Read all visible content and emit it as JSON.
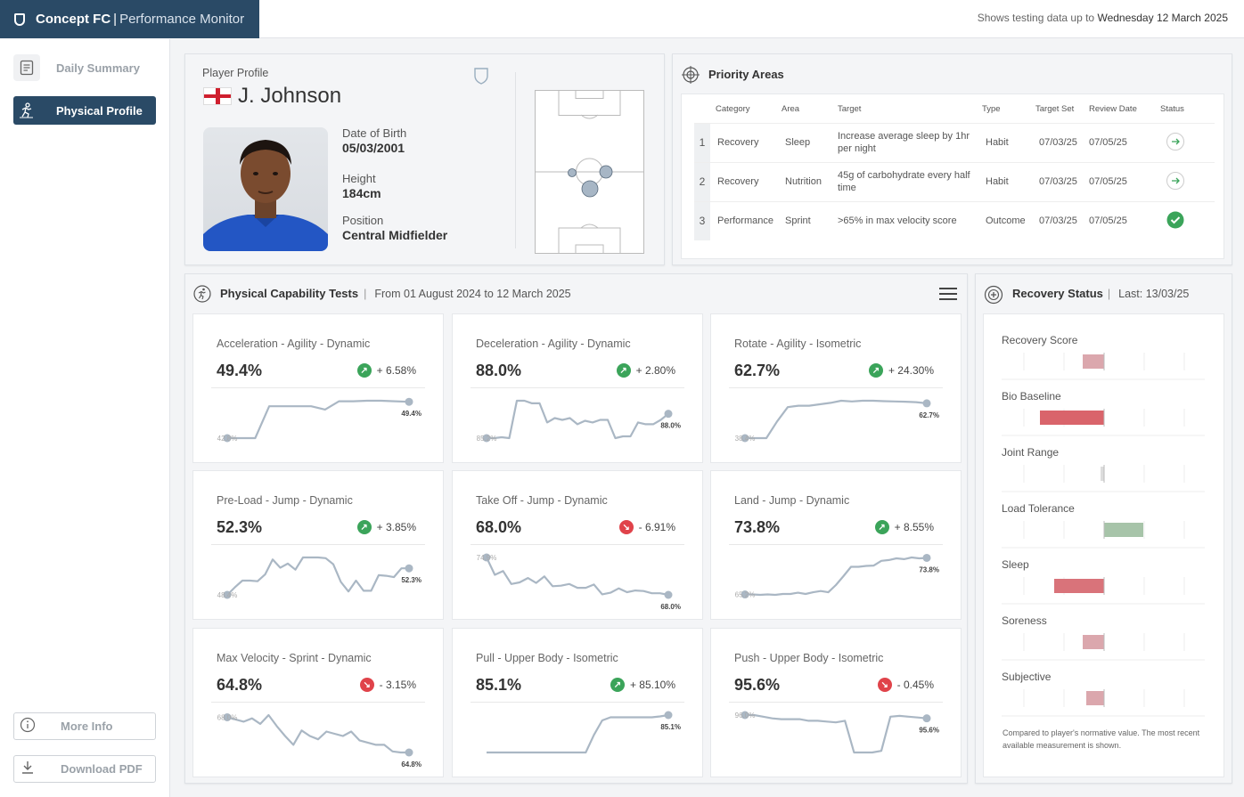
{
  "app": {
    "brand_bold": "Concept FC",
    "brand_sep": "|",
    "brand_rest": "Performance Monitor"
  },
  "data_notice": {
    "prefix": "Shows testing data up to",
    "date": "Wednesday 12 March 2025"
  },
  "sidebar": {
    "items": [
      {
        "label": "Daily Summary",
        "icon": "document-icon"
      },
      {
        "label": "Physical Profile",
        "icon": "runner-icon"
      }
    ],
    "more_info": "More Info",
    "download": "Download PDF"
  },
  "profile": {
    "section_label": "Player Profile",
    "name": "J. Johnson",
    "flag": "england-flag",
    "dob_label": "Date of Birth",
    "dob": "05/03/2001",
    "height_label": "Height",
    "height": "184cm",
    "position_label": "Position",
    "position": "Central Midfielder"
  },
  "priority": {
    "title": "Priority Areas",
    "headers": [
      "Category",
      "Area",
      "Target",
      "Type",
      "Target Set",
      "Review Date",
      "Status"
    ],
    "rows": [
      {
        "n": "1",
        "category": "Recovery",
        "area": "Sleep",
        "target": "Increase average sleep by 1hr per night",
        "type": "Habit",
        "set": "07/03/25",
        "review": "07/05/25",
        "status": "in-progress"
      },
      {
        "n": "2",
        "category": "Recovery",
        "area": "Nutrition",
        "target": "45g of carbohydrate every half time",
        "type": "Habit",
        "set": "07/03/25",
        "review": "07/05/25",
        "status": "in-progress"
      },
      {
        "n": "3",
        "category": "Performance",
        "area": "Sprint",
        "target": ">65% in max velocity score",
        "type": "Outcome",
        "set": "07/03/25",
        "review": "07/05/25",
        "status": "complete"
      }
    ]
  },
  "tests": {
    "title": "Physical Capability Tests",
    "range": "From 01 August 2024 to 12 March 2025",
    "cards": [
      {
        "title": "Acceleration - Agility - Dynamic",
        "value": "49.4%",
        "change": "+ 6.58%",
        "dir": "up",
        "start_label": "42.8%",
        "end_label": "49.4%",
        "series": [
          42.8,
          42.8,
          42.8,
          48.6,
          48.6,
          48.6,
          48.6,
          48.0,
          49.5,
          49.5,
          49.6,
          49.6,
          49.5,
          49.4
        ]
      },
      {
        "title": "Deceleration - Agility - Dynamic",
        "value": "88.0%",
        "change": "+ 2.80%",
        "dir": "up",
        "start_label": "85.2%",
        "end_label": "88.0%",
        "series": [
          85.2,
          85.2,
          85.3,
          85.2,
          89.5,
          89.5,
          89.2,
          89.2,
          87.0,
          87.5,
          87.3,
          87.5,
          86.8,
          87.2,
          87.0,
          87.3,
          87.3,
          85.2,
          85.4,
          85.4,
          87.0,
          86.8,
          86.8,
          87.3,
          88.0
        ]
      },
      {
        "title": "Rotate - Agility - Isometric",
        "value": "62.7%",
        "change": "+ 24.30%",
        "dir": "up",
        "start_label": "38.4%",
        "end_label": "62.7%",
        "series": [
          38.4,
          38.4,
          38.4,
          50.0,
          60.0,
          61.0,
          61.0,
          62.0,
          63.0,
          64.5,
          64.0,
          64.5,
          64.5,
          64.2,
          64.0,
          63.8,
          63.5,
          62.7
        ]
      },
      {
        "title": "Pre-Load - Jump - Dynamic",
        "value": "52.3%",
        "change": "+ 3.85%",
        "dir": "up",
        "start_label": "48.4%",
        "end_label": "52.3%",
        "series": [
          48.4,
          49.5,
          50.5,
          50.5,
          50.4,
          51.4,
          53.6,
          52.4,
          53.0,
          52.1,
          53.9,
          53.9,
          53.9,
          53.8,
          52.9,
          50.3,
          48.9,
          50.5,
          49.0,
          49.0,
          51.3,
          51.2,
          51.0,
          52.3,
          52.3
        ]
      },
      {
        "title": "Take Off - Jump - Dynamic",
        "value": "68.0%",
        "change": "- 6.91%",
        "dir": "down",
        "start_label": "74.9%",
        "end_label": "68.0%",
        "series": [
          74.9,
          71.7,
          72.4,
          70.0,
          70.3,
          71.1,
          70.2,
          71.4,
          69.6,
          69.7,
          70.0,
          69.3,
          69.3,
          69.9,
          68.1,
          68.4,
          69.2,
          68.5,
          68.8,
          68.7,
          68.3,
          68.3,
          68.0
        ]
      },
      {
        "title": "Land - Jump - Dynamic",
        "value": "73.8%",
        "change": "+ 8.55%",
        "dir": "up",
        "start_label": "65.2%",
        "end_label": "73.8%",
        "series": [
          65.2,
          65.2,
          65.1,
          65.2,
          65.1,
          65.3,
          65.3,
          65.6,
          65.3,
          65.7,
          66.0,
          65.7,
          67.4,
          69.5,
          71.7,
          71.7,
          71.9,
          72.0,
          73.1,
          73.3,
          73.7,
          73.5,
          73.9,
          73.7,
          73.8
        ]
      },
      {
        "title": "Max Velocity - Sprint - Dynamic",
        "value": "64.8%",
        "change": "- 3.15%",
        "dir": "down",
        "start_label": "68.0%",
        "end_label": "64.8%",
        "series": [
          68.0,
          67.8,
          67.6,
          67.9,
          67.4,
          68.2,
          67.2,
          66.3,
          65.5,
          66.8,
          66.3,
          66.0,
          66.7,
          66.5,
          66.3,
          66.7,
          65.9,
          65.7,
          65.5,
          65.5,
          64.9,
          64.8,
          64.8
        ]
      },
      {
        "title": "Pull - Upper Body - Isometric",
        "value": "85.1%",
        "change": "+ 85.10%",
        "dir": "up",
        "start_label": "",
        "end_label": "85.1%",
        "series": [
          0,
          0,
          0,
          0,
          0,
          0,
          0,
          0,
          0,
          0,
          0,
          0,
          0,
          40,
          73,
          80,
          80,
          80,
          80,
          80,
          80,
          82,
          85.1
        ]
      },
      {
        "title": "Push - Upper Body - Isometric",
        "value": "95.6%",
        "change": "- 0.45%",
        "dir": "down",
        "start_label": "96.0%",
        "end_label": "95.6%",
        "series": [
          96.0,
          96.0,
          95.8,
          95.6,
          95.5,
          95.5,
          95.5,
          95.3,
          95.3,
          95.2,
          95.1,
          95.3,
          91.4,
          91.4,
          91.4,
          91.6,
          95.8,
          95.9,
          95.8,
          95.7,
          95.6
        ]
      }
    ]
  },
  "recovery": {
    "title": "Recovery Status",
    "last": "Last: 13/03/25",
    "rows": [
      {
        "label": "Recovery Score",
        "value": -0.6,
        "color": "#dba7ad"
      },
      {
        "label": "Bio Baseline",
        "value": -1.8,
        "color": "#d9646b"
      },
      {
        "label": "Joint Range",
        "value": -0.1,
        "color": "#dcdcdc"
      },
      {
        "label": "Load Tolerance",
        "value": 1.1,
        "color": "#a7c4a9"
      },
      {
        "label": "Sleep",
        "value": -1.4,
        "color": "#d9737a"
      },
      {
        "label": "Soreness",
        "value": -0.6,
        "color": "#dba7ad"
      },
      {
        "label": "Subjective",
        "value": -0.5,
        "color": "#dba7ad"
      }
    ],
    "footnote": "Compared to player's normative value. The most recent available measurement is shown."
  },
  "colors": {
    "brand": "#2a4a66",
    "up": "#3ba45a",
    "down": "#e0434a",
    "spark": "#aab7c4"
  }
}
